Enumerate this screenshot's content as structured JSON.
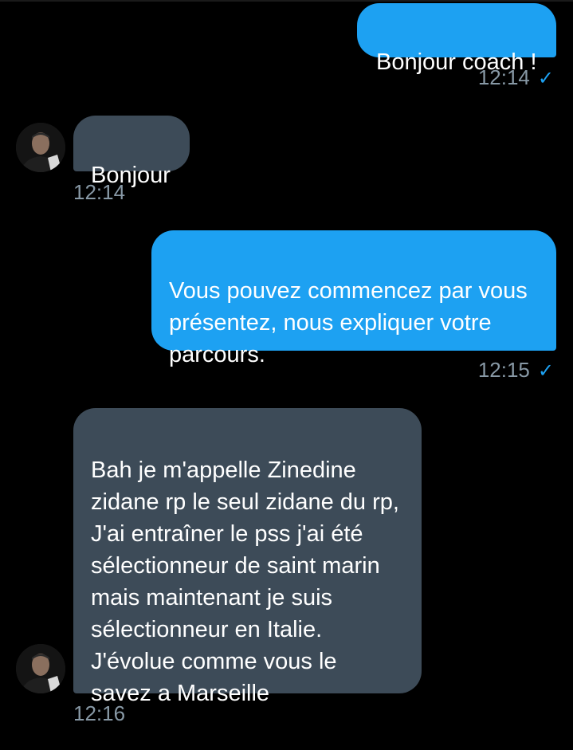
{
  "colors": {
    "background": "#000000",
    "outgoing_bubble": "#1da1f2",
    "incoming_bubble": "#3d4b58",
    "timestamp": "#8899a6",
    "read_check": "#1da1f2"
  },
  "messages": [
    {
      "direction": "outgoing",
      "text": "Bonjour coach !",
      "time": "12:14",
      "status_icon": "check-icon"
    },
    {
      "direction": "incoming",
      "text": "Bonjour",
      "time": "12:14",
      "avatar_icon": "contact-avatar"
    },
    {
      "direction": "outgoing",
      "text": "Vous pouvez commencez par vous\nprésentez, nous expliquer votre\nparcours.",
      "time": "12:15",
      "status_icon": "check-icon"
    },
    {
      "direction": "incoming",
      "text": "Bah je m'appelle Zinedine\nzidane rp le seul zidane du rp,\nJ'ai entraîner le pss j'ai été\nsélectionneur de saint marin\nmais maintenant je suis\nsélectionneur en Italie.\nJ'évolue comme vous le\nsavez a Marseille",
      "time": "12:16",
      "avatar_icon": "contact-avatar"
    }
  ],
  "check_glyph": "✓"
}
